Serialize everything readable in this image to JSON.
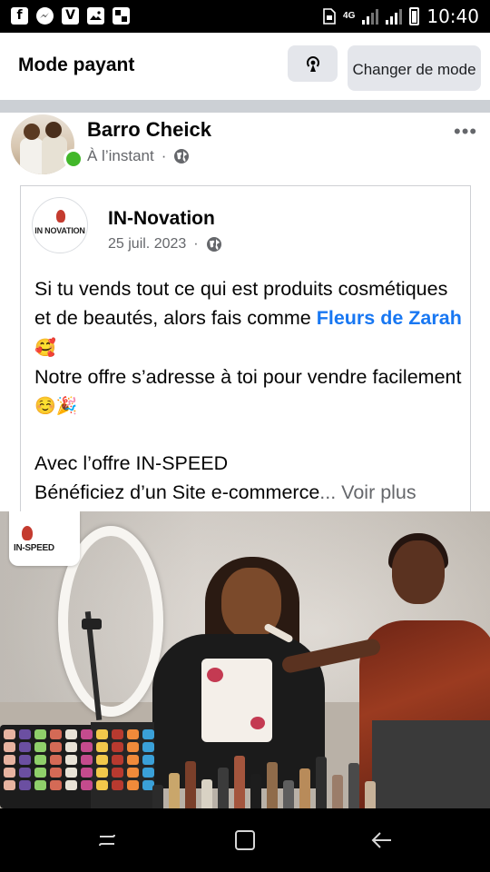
{
  "status_bar": {
    "notification_icons": [
      "facebook-icon",
      "messenger-icon",
      "vlc-icon",
      "gallery-icon",
      "gallery-alt-icon"
    ],
    "network_type": "4G",
    "time": "10:40"
  },
  "header": {
    "title": "Mode payant",
    "change_mode_label": "Changer de mode",
    "cast_icon": "broadcast-icon"
  },
  "post": {
    "author": "Barro Cheick",
    "timestamp": "À l’instant",
    "separator": "·",
    "privacy_icon": "globe-icon",
    "more_label": "•••"
  },
  "shared_post": {
    "page_name": "IN-Novation",
    "logo_text": "IN NOVATION",
    "date": "25 juil. 2023",
    "separator": "·",
    "text": {
      "line1": "Si tu vends tout ce qui est produits cosmétiques et de beautés, alors fais comme ",
      "mention": "Fleurs de Zarah",
      "emoji1": " 🥰",
      "line2": "Notre offre s’adresse à toi pour vendre facilement ",
      "emoji2": "☺️🎉",
      "line3": "Avec l’offre IN-SPEED",
      "line4": "Bénéficiez d’un Site e-commerce",
      "ellipsis": "...",
      "see_more": " Voir plus"
    }
  },
  "photo": {
    "watermark_text": "IN-SPEED"
  },
  "nav_bar": {
    "recent_icon": "recent-apps-icon",
    "home_icon": "home-icon",
    "back_icon": "back-icon"
  },
  "colors": {
    "accent_link": "#1877f2",
    "online_dot": "#42b72a",
    "button_bg": "#e4e6eb",
    "divider": "#ccd0d5"
  }
}
